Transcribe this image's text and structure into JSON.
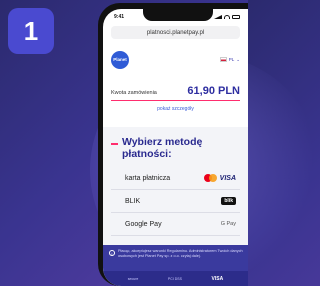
{
  "step": {
    "number": "1"
  },
  "status": {
    "time": "9:41"
  },
  "browser": {
    "url": "platnosci.planetpay.pl"
  },
  "header": {
    "logo_text": "Planet",
    "language": "PL"
  },
  "order": {
    "amount_label": "Kwota zamówienia",
    "amount_value": "61,90 PLN",
    "details_link": "pokaż szczegóły"
  },
  "payment": {
    "title_line1": "Wybierz metodę",
    "title_line2": "płatności:",
    "methods": [
      {
        "label": "karta płatnicza",
        "brand": "VISA"
      },
      {
        "label": "BLIK",
        "brand": "blik"
      },
      {
        "label": "Google Pay",
        "brand": "G Pay"
      }
    ]
  },
  "consent": {
    "text": "Płacąc, akceptujesz warunki Regulaminu. Administratorem Twoich danych osobowych jest Planet Pay sp. z o.o. czytaj dalej."
  },
  "footer": {
    "items": [
      "secure",
      "PCI DSS",
      "VISA"
    ]
  },
  "colors": {
    "accent": "#ff2d6e",
    "brand": "#2d2da0",
    "badge": "#4a4ad0"
  },
  "icons": {
    "step": "step-number-badge",
    "logo": "planet-logo",
    "info": "info-icon",
    "card": "mastercard-visa-logos",
    "blik": "blik-logo",
    "gpay": "google-pay-logo"
  }
}
